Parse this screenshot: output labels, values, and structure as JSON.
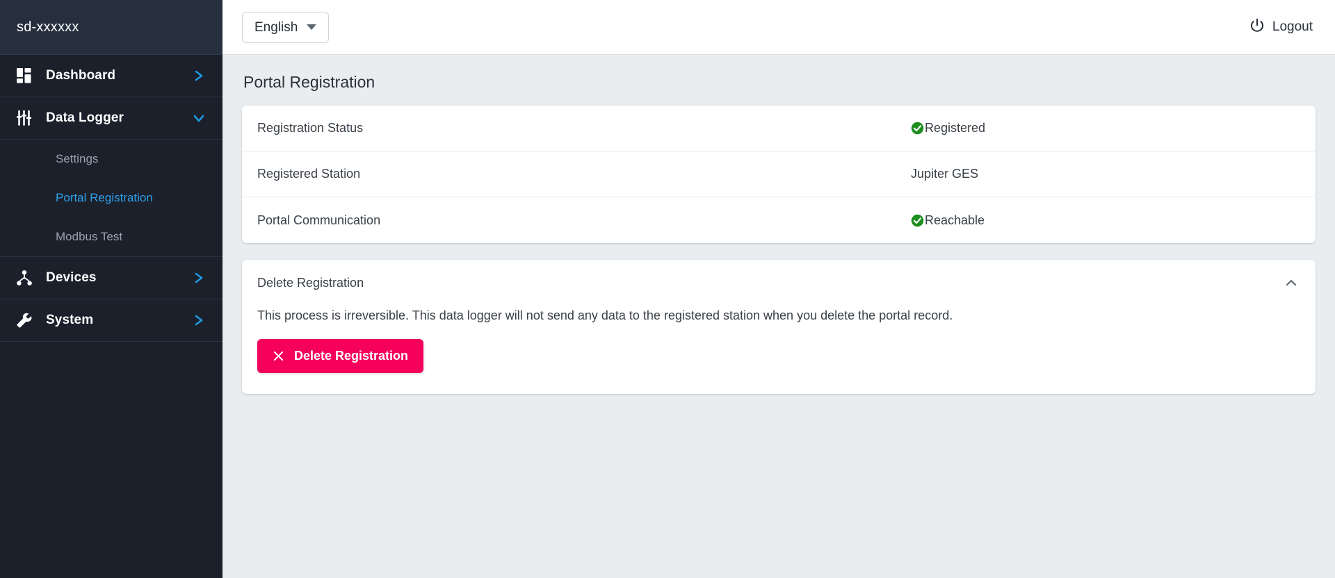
{
  "sidebar": {
    "device_name": "sd-xxxxxx",
    "items": [
      {
        "label": "Dashboard",
        "icon": "dashboard-grid-icon",
        "chevron": "chevron-right-icon",
        "expanded": false
      },
      {
        "label": "Data Logger",
        "icon": "sliders-icon",
        "chevron": "chevron-down-icon",
        "expanded": true
      },
      {
        "label": "Devices",
        "icon": "sitemap-icon",
        "chevron": "chevron-right-icon",
        "expanded": false
      },
      {
        "label": "System",
        "icon": "wrench-icon",
        "chevron": "chevron-right-icon",
        "expanded": false
      }
    ],
    "data_logger_subitems": [
      {
        "label": "Settings",
        "active": false
      },
      {
        "label": "Portal Registration",
        "active": true
      },
      {
        "label": "Modbus Test",
        "active": false
      }
    ],
    "active_color": "#2f9fe8"
  },
  "topbar": {
    "language": {
      "selected": "English",
      "icon": "caret-down-icon"
    },
    "logout": {
      "label": "Logout",
      "icon": "power-icon"
    }
  },
  "page": {
    "title": "Portal Registration"
  },
  "status_card": {
    "rows": [
      {
        "label": "Registration Status",
        "value": "Registered",
        "icon": "check-circle-icon",
        "has_icon": true
      },
      {
        "label": "Registered Station",
        "value": "Jupiter GES",
        "icon": "",
        "has_icon": false
      },
      {
        "label": "Portal Communication",
        "value": "Reachable",
        "icon": "check-circle-icon",
        "has_icon": true
      }
    ],
    "ok_color": "#1e8e1e"
  },
  "delete_section": {
    "title": "Delete Registration",
    "toggle_icon": "chevron-up-icon",
    "warning": "This process is irreversible. This data logger will not send any data to the registered station when you delete the portal record.",
    "button": {
      "label": "Delete Registration",
      "icon": "close-x-icon",
      "color": "#f5005a"
    }
  }
}
